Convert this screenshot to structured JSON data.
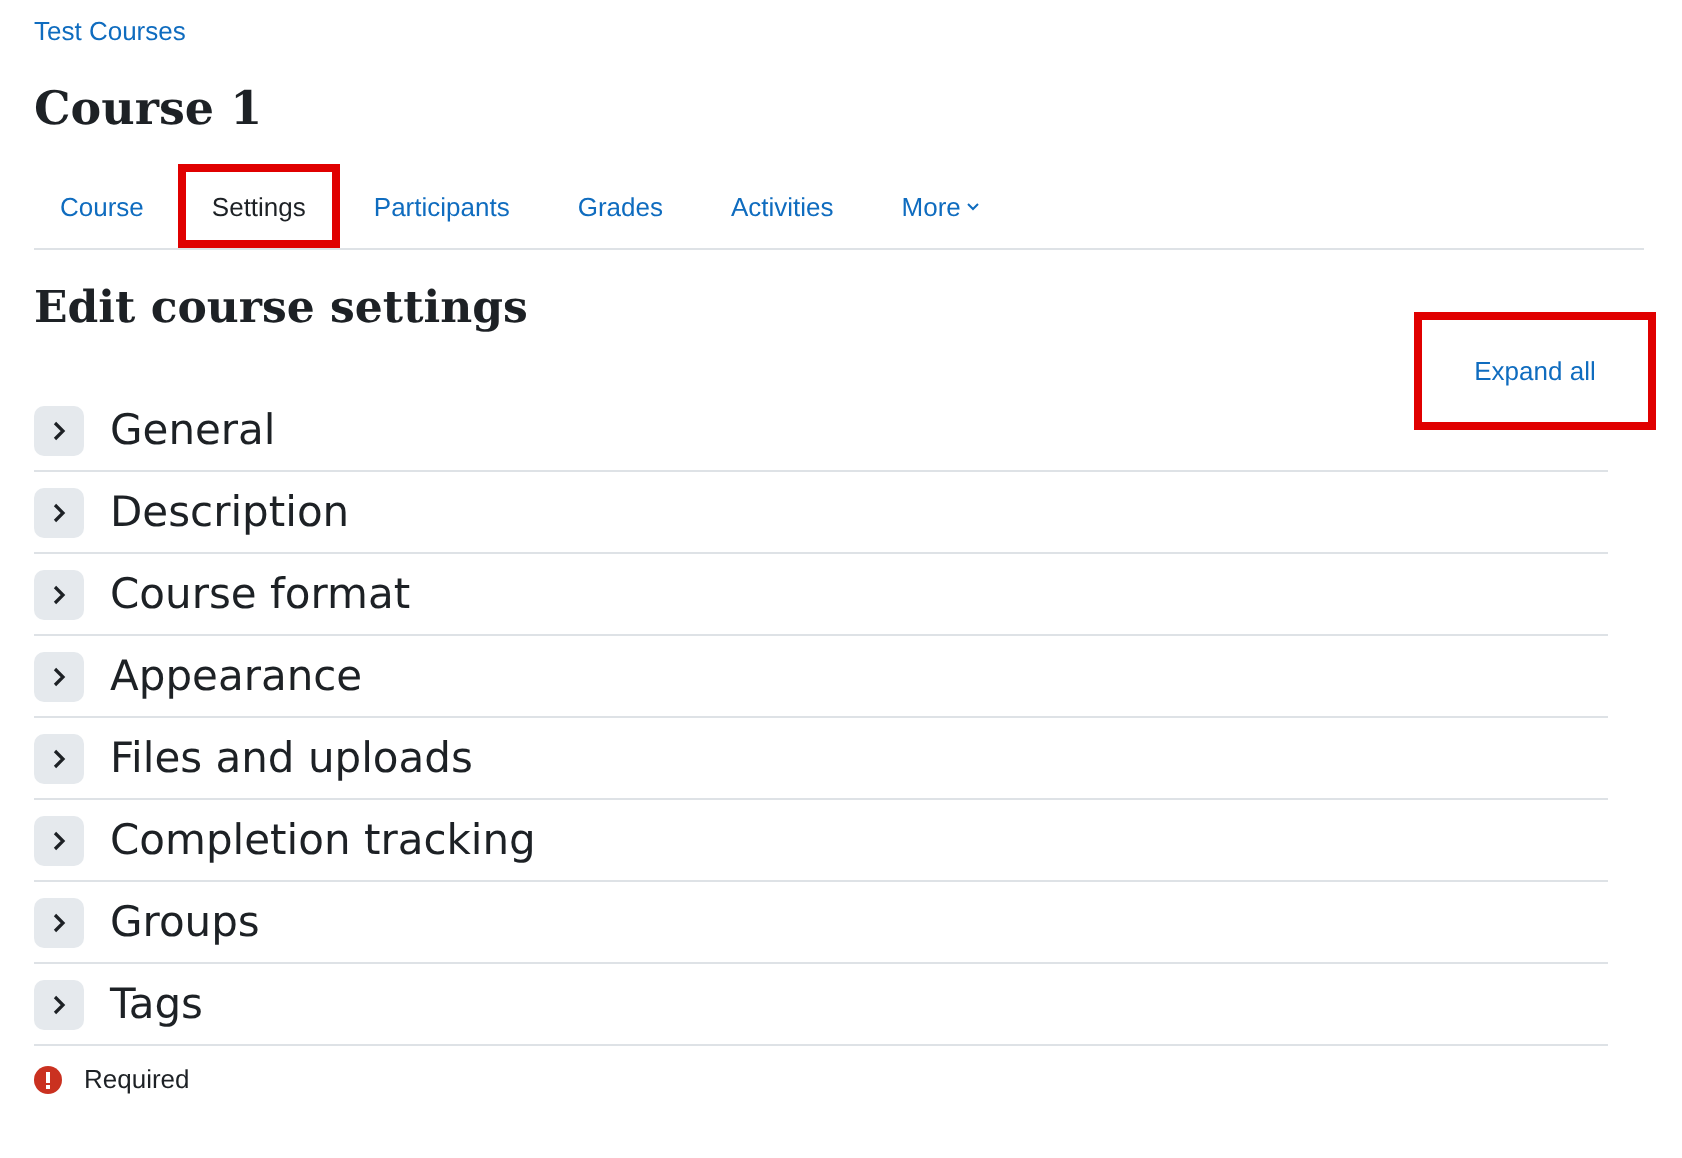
{
  "breadcrumb": "Test Courses",
  "page_title": "Course 1",
  "tabs": [
    {
      "label": "Course",
      "selected": false,
      "highlighted": false
    },
    {
      "label": "Settings",
      "selected": true,
      "highlighted": true
    },
    {
      "label": "Participants",
      "selected": false,
      "highlighted": false
    },
    {
      "label": "Grades",
      "selected": false,
      "highlighted": false
    },
    {
      "label": "Activities",
      "selected": false,
      "highlighted": false
    },
    {
      "label": "More",
      "selected": false,
      "highlighted": false,
      "kind": "dropdown"
    }
  ],
  "heading": "Edit course settings",
  "expand_all": {
    "label": "Expand all",
    "highlighted": true
  },
  "sections": [
    {
      "title": "General",
      "expanded": false
    },
    {
      "title": "Description",
      "expanded": false
    },
    {
      "title": "Course format",
      "expanded": false
    },
    {
      "title": "Appearance",
      "expanded": false
    },
    {
      "title": "Files and uploads",
      "expanded": false
    },
    {
      "title": "Completion tracking",
      "expanded": false
    },
    {
      "title": "Groups",
      "expanded": false
    },
    {
      "title": "Tags",
      "expanded": false
    }
  ],
  "required_note": "Required"
}
